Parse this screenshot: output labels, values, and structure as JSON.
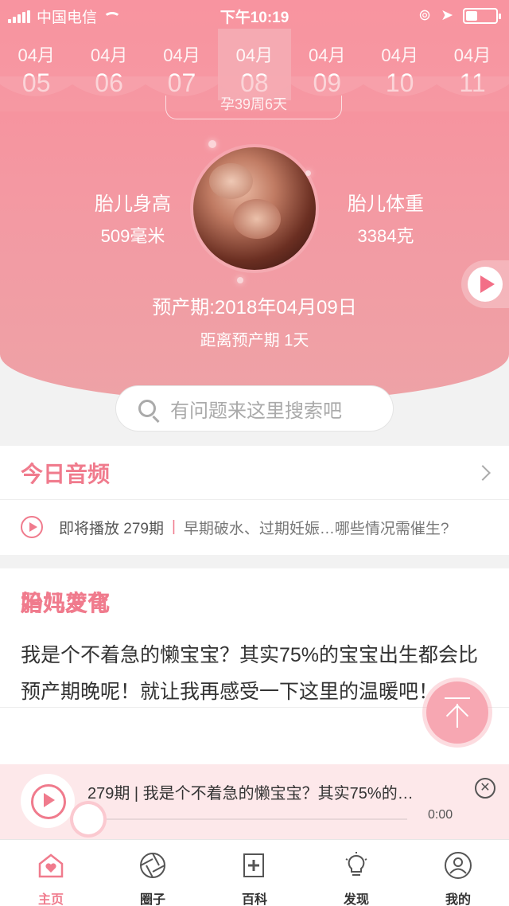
{
  "status_bar": {
    "carrier": "中国电信",
    "time": "下午10:19"
  },
  "date_strip": [
    {
      "month": "04月",
      "day": "05"
    },
    {
      "month": "04月",
      "day": "06"
    },
    {
      "month": "04月",
      "day": "07"
    },
    {
      "month": "04月",
      "day": "08",
      "active": true
    },
    {
      "month": "04月",
      "day": "09"
    },
    {
      "month": "04月",
      "day": "10"
    },
    {
      "month": "04月",
      "day": "11"
    }
  ],
  "week_label": "孕39周6天",
  "fetal": {
    "height_label": "胎儿身高",
    "height_value": "509毫米",
    "weight_label": "胎儿体重",
    "weight_value": "3384克"
  },
  "due_date": "预产期:2018年04月09日",
  "countdown": "距离预产期 1天",
  "search": {
    "placeholder": "有问题来这里搜索吧"
  },
  "audio": {
    "title": "今日音频",
    "upcoming": "即将播放 279期",
    "separator": "|",
    "episode_title": "早期破水、过期妊娠…哪些情况需催生?"
  },
  "growth": {
    "title": "胎儿发育",
    "text": "我是个不着急的懒宝宝？其实75%的宝宝出生都会比预产期晚呢！就让我再感受一下这里的温暖吧！"
  },
  "mom": {
    "title": "妈妈变化"
  },
  "player": {
    "title": "279期 | 我是个不着急的懒宝宝？其实75%的…",
    "time": "0:00",
    "close_icon": "close-icon"
  },
  "tabs": [
    {
      "label": "主页",
      "icon": "home-heart-icon",
      "active": true
    },
    {
      "label": "圈子",
      "icon": "aperture-icon"
    },
    {
      "label": "百科",
      "icon": "encyclopedia-icon"
    },
    {
      "label": "发现",
      "icon": "lightbulb-icon"
    },
    {
      "label": "我的",
      "icon": "user-icon"
    }
  ],
  "colors": {
    "accent": "#f07b8d",
    "hero_top": "#f98e9b",
    "hero_bottom": "#eea2a6",
    "player_bg": "#fde8ea"
  }
}
